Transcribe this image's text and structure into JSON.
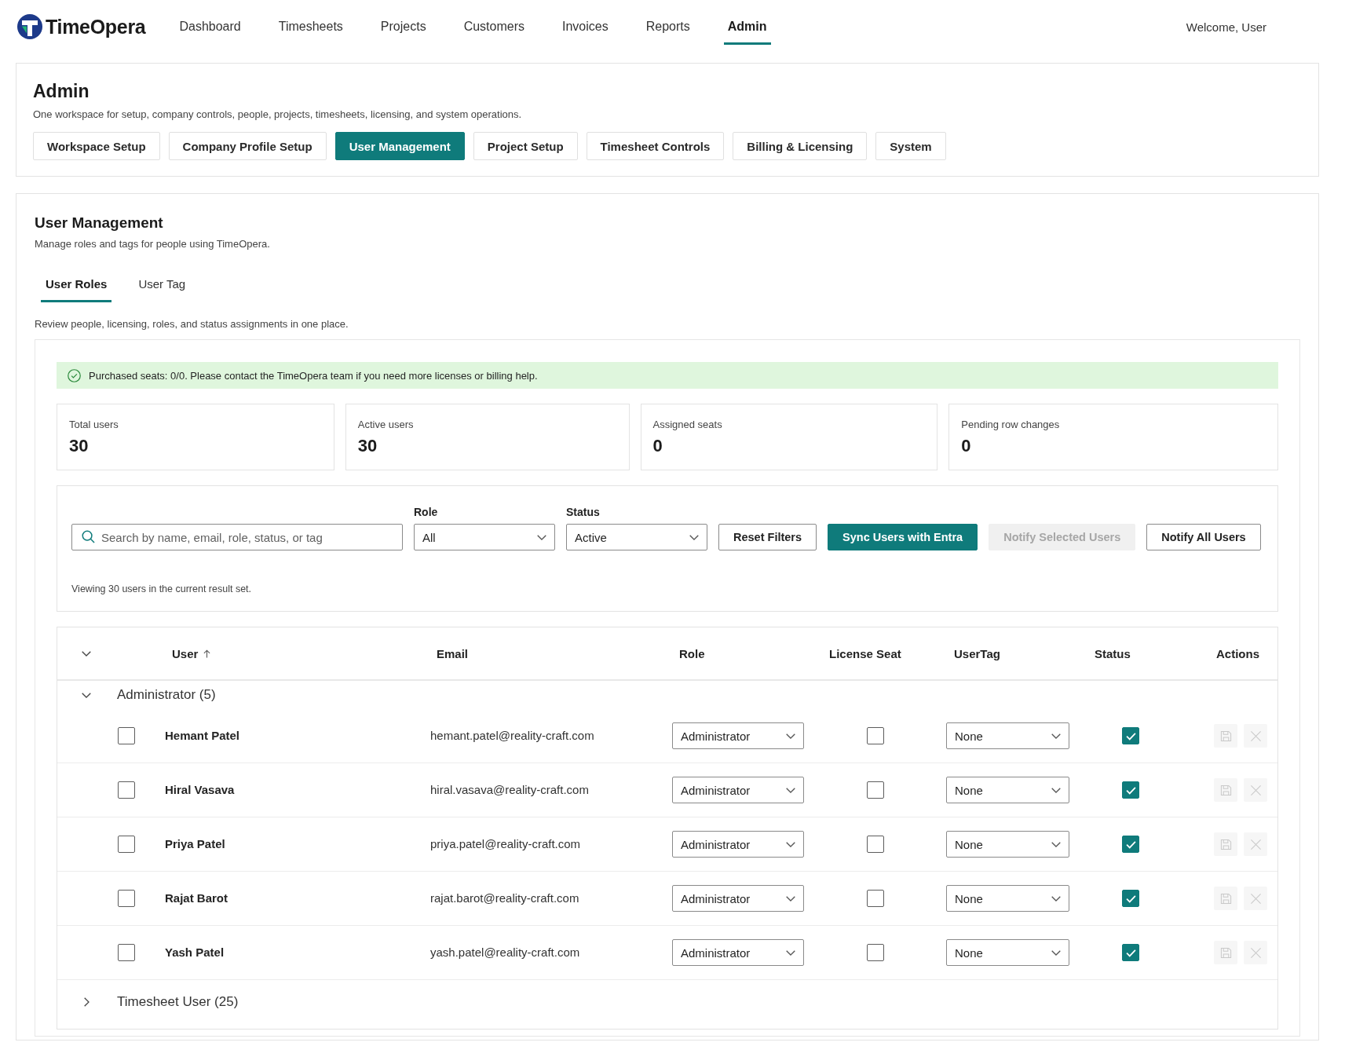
{
  "header": {
    "brand": "TimeOpera",
    "nav": [
      {
        "label": "Dashboard",
        "selected": false
      },
      {
        "label": "Timesheets",
        "selected": false
      },
      {
        "label": "Projects",
        "selected": false
      },
      {
        "label": "Customers",
        "selected": false
      },
      {
        "label": "Invoices",
        "selected": false
      },
      {
        "label": "Reports",
        "selected": false
      },
      {
        "label": "Admin",
        "selected": true
      }
    ],
    "welcome": "Welcome, User"
  },
  "admin": {
    "title": "Admin",
    "subtitle": "One workspace for setup, company controls, people, projects, timesheets, licensing, and system operations.",
    "sections": [
      {
        "label": "Workspace Setup",
        "selected": false
      },
      {
        "label": "Company Profile Setup",
        "selected": false
      },
      {
        "label": "User Management",
        "selected": true
      },
      {
        "label": "Project Setup",
        "selected": false
      },
      {
        "label": "Timesheet Controls",
        "selected": false
      },
      {
        "label": "Billing & Licensing",
        "selected": false
      },
      {
        "label": "System",
        "selected": false
      }
    ]
  },
  "user_management": {
    "title": "User Management",
    "subtitle": "Manage roles and tags for people using TimeOpera.",
    "tabs": [
      {
        "label": "User Roles",
        "selected": true
      },
      {
        "label": "User Tag",
        "selected": false
      }
    ],
    "description": "Review people, licensing, roles, and status assignments in one place.",
    "banner": {
      "kind": "success",
      "text": "Purchased seats: 0/0. Please contact the TimeOpera team if you need more licenses or billing help."
    },
    "stats": [
      {
        "label": "Total users",
        "value": "30"
      },
      {
        "label": "Active users",
        "value": "30"
      },
      {
        "label": "Assigned seats",
        "value": "0"
      },
      {
        "label": "Pending row changes",
        "value": "0"
      }
    ],
    "filters": {
      "search": {
        "placeholder": "Search by name, email, role, status, or tag"
      },
      "selects": [
        {
          "label": "Role",
          "value": "All"
        },
        {
          "label": "Status",
          "value": "Active"
        }
      ],
      "buttons": [
        {
          "label": "Reset Filters",
          "kind": "secondary",
          "disabled": false
        },
        {
          "label": "Sync Users with Entra",
          "kind": "primary",
          "disabled": false
        },
        {
          "label": "Notify Selected Users",
          "kind": "secondary",
          "disabled": true
        },
        {
          "label": "Notify All Users",
          "kind": "secondary",
          "disabled": false
        }
      ],
      "result_summary": "Viewing 30 users in the current result set."
    },
    "table": {
      "columns": [
        {
          "label": "User",
          "sorted_ascending": true
        },
        {
          "label": "Email",
          "sorted_ascending": false
        },
        {
          "label": "Role",
          "sorted_ascending": false
        },
        {
          "label": "License Seat",
          "sorted_ascending": false
        },
        {
          "label": "UserTag",
          "sorted_ascending": false
        },
        {
          "label": "Status",
          "sorted_ascending": false
        },
        {
          "label": "Actions",
          "sorted_ascending": false
        }
      ],
      "groups": [
        {
          "label": "Administrator (5)",
          "expanded": true,
          "rows": [
            {
              "selected": false,
              "name": "Hemant Patel",
              "email": "hemant.patel@reality-craft.com",
              "role": "Administrator",
              "license_seat": false,
              "user_tag": "None",
              "active": true,
              "has_changes": false
            },
            {
              "selected": false,
              "name": "Hiral Vasava",
              "email": "hiral.vasava@reality-craft.com",
              "role": "Administrator",
              "license_seat": false,
              "user_tag": "None",
              "active": true,
              "has_changes": false
            },
            {
              "selected": false,
              "name": "Priya Patel",
              "email": "priya.patel@reality-craft.com",
              "role": "Administrator",
              "license_seat": false,
              "user_tag": "None",
              "active": true,
              "has_changes": false
            },
            {
              "selected": false,
              "name": "Rajat Barot",
              "email": "rajat.barot@reality-craft.com",
              "role": "Administrator",
              "license_seat": false,
              "user_tag": "None",
              "active": true,
              "has_changes": false
            },
            {
              "selected": false,
              "name": "Yash Patel",
              "email": "yash.patel@reality-craft.com",
              "role": "Administrator",
              "license_seat": false,
              "user_tag": "None",
              "active": true,
              "has_changes": false
            }
          ]
        },
        {
          "label": "Timesheet User (25)",
          "expanded": false
        }
      ]
    }
  }
}
